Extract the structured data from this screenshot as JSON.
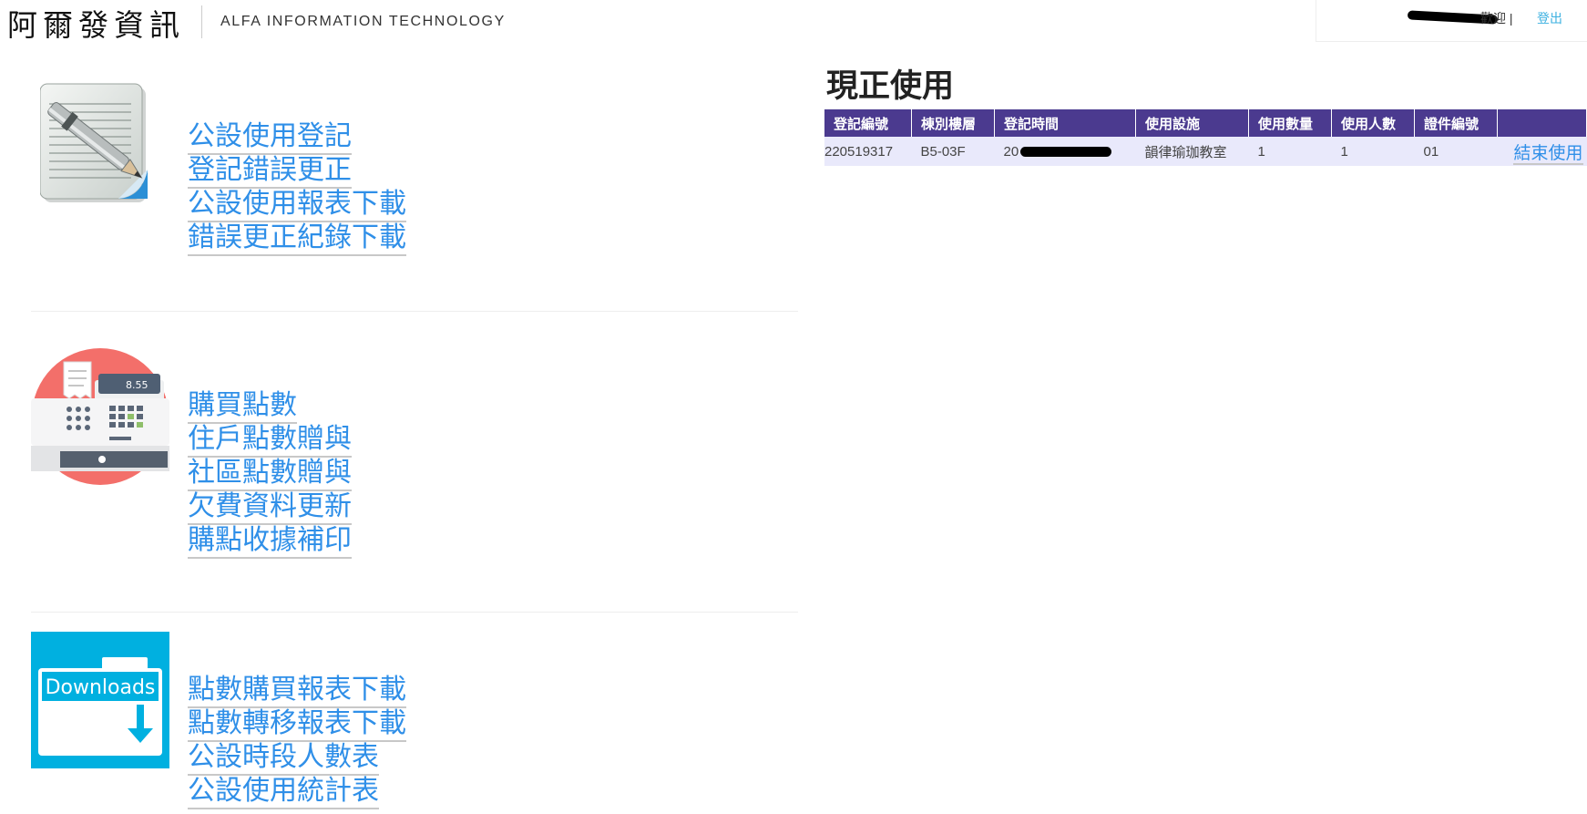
{
  "header": {
    "logo_cn": "阿爾發資訊",
    "logo_en": "ALFA INFORMATION TECHNOLOGY",
    "welcome": "歡迎 |",
    "logout": "登出"
  },
  "menu": {
    "facility": [
      "公設使用登記",
      "登記錯誤更正",
      "公設使用報表下載",
      "錯誤更正紀錄下載"
    ],
    "points": [
      "購買點數",
      "住戶點數贈與",
      "社區點數贈與",
      "欠費資料更新",
      "購點收據補印"
    ],
    "reports": [
      "點數購買報表下載",
      "點數轉移報表下載",
      "公設時段人數表",
      "公設使用統計表"
    ]
  },
  "icons": {
    "register_price": "8.55",
    "downloads_label": "Downloads"
  },
  "current_use": {
    "title": "現正使用",
    "columns": [
      "登記編號",
      "棟別樓層",
      "登記時間",
      "使用設施",
      "使用數量",
      "使用人數",
      "證件編號"
    ],
    "rows": [
      {
        "id": "220519317",
        "floor": "B5-03F",
        "time_prefix": "20",
        "facility": "韻律瑜珈教室",
        "quantity": "1",
        "people": "1",
        "card": "01",
        "action": "結束使用"
      }
    ]
  },
  "colors": {
    "link": "#2f8fe8",
    "table_header": "#4b3a8f",
    "table_row": "#e9e9fb",
    "register_circle": "#f36f6a",
    "downloads_bg": "#00b0e0"
  }
}
